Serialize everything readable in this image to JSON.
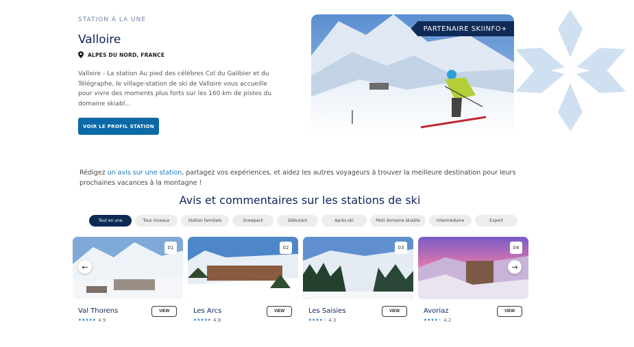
{
  "featured": {
    "eyebrow": "STATION À LA UNE",
    "title": "Valloire",
    "region": "ALPES DU NORD, FRANCE",
    "description": "Valloire - La station Au pied des célèbres Col du Galibier et du Télégraphe, le village-station de ski de Valloire vous accueille pour vivre des moments plus forts sur les 160 km de pistes du domaine skiabl...",
    "profile_button": "VOIR LE PROFIL STATION",
    "partner_badge": "PARTENAIRE SKIINFO+"
  },
  "intro": {
    "before": "Rédigez ",
    "link": "un avis sur une station",
    "after": ", partagez vos expériences, et aidez les autres voyageurs à trouver la meilleure destination pour leurs prochaines vacances à la montagne !"
  },
  "section_title": "Avis et commentaires sur les stations de ski",
  "filters": [
    "Tout en une",
    "Tous niveaux",
    "Station familiale",
    "Snowpark",
    "Débutant",
    "Après-ski",
    "Petit domaine skiable",
    "Intermédiaire",
    "Expert"
  ],
  "active_filter": "Tout en une",
  "cards": [
    {
      "num": "01",
      "name": "Val Thorens",
      "rating": "4.9",
      "stars": 5,
      "view": "VIEW"
    },
    {
      "num": "02",
      "name": "Les Arcs",
      "rating": "4.8",
      "stars": 5,
      "view": "VIEW"
    },
    {
      "num": "03",
      "name": "Les Saisies",
      "rating": "4.3",
      "stars": 4,
      "view": "VIEW"
    },
    {
      "num": "04",
      "name": "Avoriaz",
      "rating": "4.2",
      "stars": 4,
      "view": "VIEW"
    }
  ],
  "carousel": {
    "prev": "←",
    "next": "→"
  },
  "colors": {
    "navy": "#0f2a55",
    "accent_blue": "#0b6aa6",
    "link_blue": "#1a78c2",
    "flake": "#c9ddf0"
  }
}
